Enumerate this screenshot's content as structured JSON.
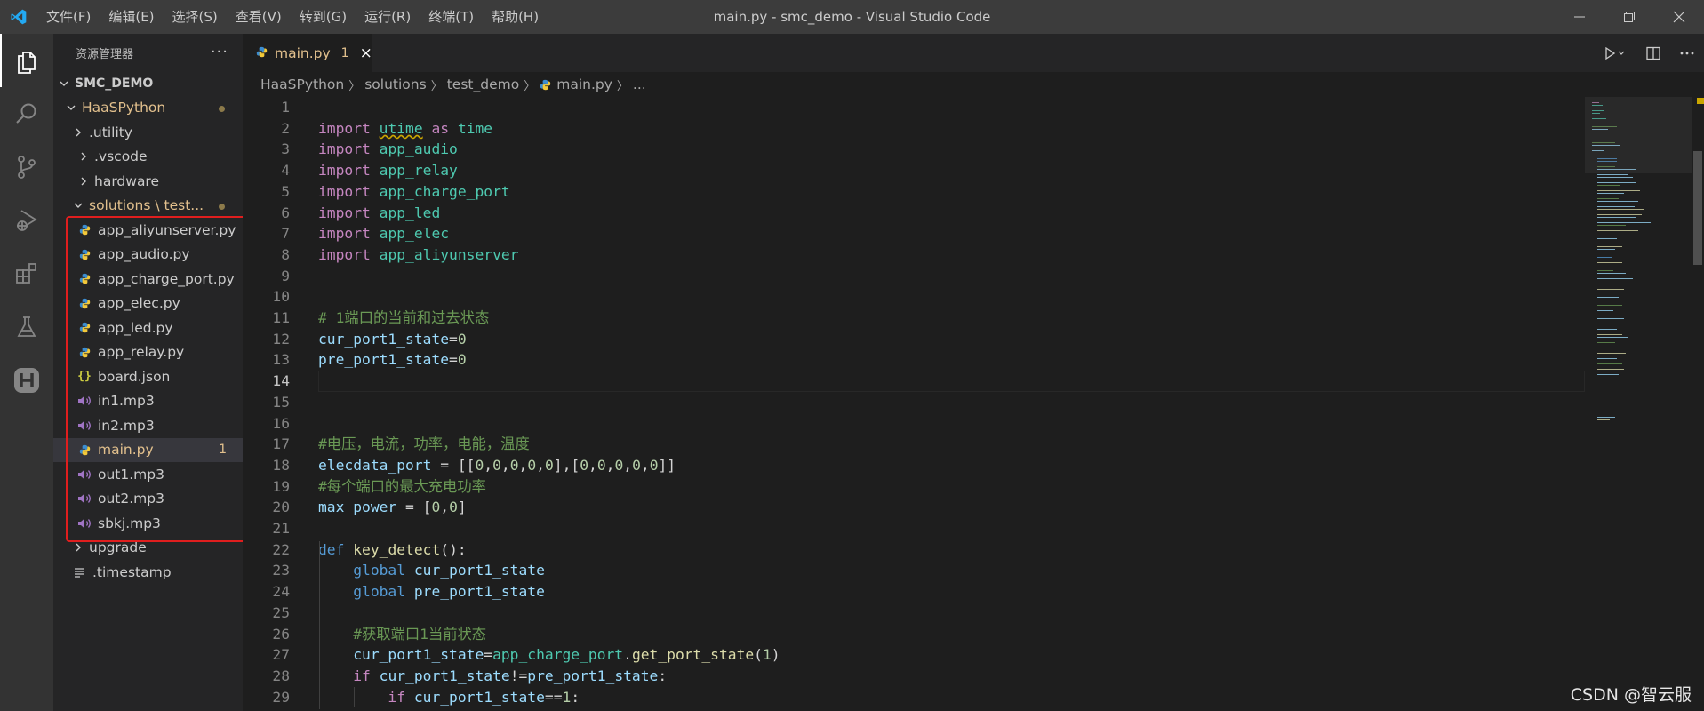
{
  "titlebar": {
    "menu": [
      "文件(F)",
      "编辑(E)",
      "选择(S)",
      "查看(V)",
      "转到(G)",
      "运行(R)",
      "终端(T)",
      "帮助(H)"
    ],
    "window_title": "main.py - smc_demo - Visual Studio Code"
  },
  "activity_bar": {
    "items": [
      "files-icon",
      "search-icon",
      "source-control-icon",
      "run-debug-icon",
      "extensions-icon",
      "testing-flask-icon",
      "haas-icon"
    ],
    "active": "files-icon"
  },
  "sidebar": {
    "title": "资源管理器",
    "more": "···",
    "root": "SMC_DEMO",
    "tree": [
      {
        "label": "HaaSPython",
        "type": "folder",
        "expanded": true,
        "modified": true
      },
      {
        "label": ".utility",
        "type": "folder",
        "expanded": false
      },
      {
        "label": ".vscode",
        "type": "folder",
        "expanded": false
      },
      {
        "label": "hardware",
        "type": "folder",
        "expanded": false
      },
      {
        "label": "solutions \\ test...",
        "type": "folder",
        "expanded": true,
        "modified": true
      },
      {
        "label": "app_aliyunserver.py",
        "type": "py"
      },
      {
        "label": "app_audio.py",
        "type": "py"
      },
      {
        "label": "app_charge_port.py",
        "type": "py"
      },
      {
        "label": "app_elec.py",
        "type": "py"
      },
      {
        "label": "app_led.py",
        "type": "py"
      },
      {
        "label": "app_relay.py",
        "type": "py"
      },
      {
        "label": "board.json",
        "type": "json"
      },
      {
        "label": "in1.mp3",
        "type": "mp3"
      },
      {
        "label": "in2.mp3",
        "type": "mp3"
      },
      {
        "label": "main.py",
        "type": "py",
        "selected": true,
        "badge": "1"
      },
      {
        "label": "out1.mp3",
        "type": "mp3"
      },
      {
        "label": "out2.mp3",
        "type": "mp3"
      },
      {
        "label": "sbkj.mp3",
        "type": "mp3"
      },
      {
        "label": "upgrade",
        "type": "folder",
        "expanded": false
      },
      {
        "label": ".timestamp",
        "type": "text"
      }
    ]
  },
  "editor": {
    "tab": {
      "label": "main.py",
      "problems": "1",
      "close": "×"
    },
    "breadcrumb": [
      "HaaSPython",
      "solutions",
      "test_demo",
      "main.py",
      "..."
    ],
    "current_line": 14,
    "lines": [
      {
        "n": "1",
        "tokens": []
      },
      {
        "n": "2",
        "tokens": [
          [
            "k",
            "import"
          ],
          [
            "p",
            " "
          ],
          [
            "m sq",
            "utime"
          ],
          [
            "p",
            " "
          ],
          [
            "k",
            "as"
          ],
          [
            "p",
            " "
          ],
          [
            "m",
            "time"
          ]
        ]
      },
      {
        "n": "3",
        "tokens": [
          [
            "k",
            "import"
          ],
          [
            "p",
            " "
          ],
          [
            "m",
            "app_audio"
          ]
        ]
      },
      {
        "n": "4",
        "tokens": [
          [
            "k",
            "import"
          ],
          [
            "p",
            " "
          ],
          [
            "m",
            "app_relay"
          ]
        ]
      },
      {
        "n": "5",
        "tokens": [
          [
            "k",
            "import"
          ],
          [
            "p",
            " "
          ],
          [
            "m",
            "app_charge_port"
          ]
        ]
      },
      {
        "n": "6",
        "tokens": [
          [
            "k",
            "import"
          ],
          [
            "p",
            " "
          ],
          [
            "m",
            "app_led"
          ]
        ]
      },
      {
        "n": "7",
        "tokens": [
          [
            "k",
            "import"
          ],
          [
            "p",
            " "
          ],
          [
            "m",
            "app_elec"
          ]
        ]
      },
      {
        "n": "8",
        "tokens": [
          [
            "k",
            "import"
          ],
          [
            "p",
            " "
          ],
          [
            "m",
            "app_aliyunserver"
          ]
        ]
      },
      {
        "n": "9",
        "tokens": []
      },
      {
        "n": "10",
        "tokens": []
      },
      {
        "n": "11",
        "tokens": [
          [
            "c",
            "# 1端口的当前和过去状态"
          ]
        ]
      },
      {
        "n": "12",
        "tokens": [
          [
            "v",
            "cur_port1_state"
          ],
          [
            "p",
            "="
          ],
          [
            "n",
            "0"
          ]
        ]
      },
      {
        "n": "13",
        "tokens": [
          [
            "v",
            "pre_port1_state"
          ],
          [
            "p",
            "="
          ],
          [
            "n",
            "0"
          ]
        ]
      },
      {
        "n": "14",
        "tokens": []
      },
      {
        "n": "15",
        "tokens": []
      },
      {
        "n": "16",
        "tokens": []
      },
      {
        "n": "17",
        "tokens": [
          [
            "c",
            "#电压，电流，功率，电能，温度"
          ]
        ]
      },
      {
        "n": "18",
        "tokens": [
          [
            "v",
            "elecdata_port"
          ],
          [
            "p",
            " = [["
          ],
          [
            "n",
            "0"
          ],
          [
            "p",
            ","
          ],
          [
            "n",
            "0"
          ],
          [
            "p",
            ","
          ],
          [
            "n",
            "0"
          ],
          [
            "p",
            ","
          ],
          [
            "n",
            "0"
          ],
          [
            "p",
            ","
          ],
          [
            "n",
            "0"
          ],
          [
            "p",
            "],["
          ],
          [
            "n",
            "0"
          ],
          [
            "p",
            ","
          ],
          [
            "n",
            "0"
          ],
          [
            "p",
            ","
          ],
          [
            "n",
            "0"
          ],
          [
            "p",
            ","
          ],
          [
            "n",
            "0"
          ],
          [
            "p",
            ","
          ],
          [
            "n",
            "0"
          ],
          [
            "p",
            "]]"
          ]
        ]
      },
      {
        "n": "19",
        "tokens": [
          [
            "c",
            "#每个端口的最大充电功率"
          ]
        ]
      },
      {
        "n": "20",
        "tokens": [
          [
            "v",
            "max_power"
          ],
          [
            "p",
            " = ["
          ],
          [
            "n",
            "0"
          ],
          [
            "p",
            ","
          ],
          [
            "n",
            "0"
          ],
          [
            "p",
            "]"
          ]
        ]
      },
      {
        "n": "21",
        "tokens": []
      },
      {
        "n": "22",
        "tokens": [
          [
            "kb",
            "def"
          ],
          [
            "p",
            " "
          ],
          [
            "f",
            "key_detect"
          ],
          [
            "p",
            "():"
          ]
        ]
      },
      {
        "n": "23",
        "tokens": [
          [
            "p",
            "    "
          ],
          [
            "kb",
            "global"
          ],
          [
            "p",
            " "
          ],
          [
            "v",
            "cur_port1_state"
          ]
        ]
      },
      {
        "n": "24",
        "tokens": [
          [
            "p",
            "    "
          ],
          [
            "kb",
            "global"
          ],
          [
            "p",
            " "
          ],
          [
            "v",
            "pre_port1_state"
          ]
        ]
      },
      {
        "n": "25",
        "tokens": []
      },
      {
        "n": "26",
        "tokens": [
          [
            "p",
            "    "
          ],
          [
            "c",
            "#获取端口1当前状态"
          ]
        ]
      },
      {
        "n": "27",
        "tokens": [
          [
            "p",
            "    "
          ],
          [
            "v",
            "cur_port1_state"
          ],
          [
            "p",
            "="
          ],
          [
            "m",
            "app_charge_port"
          ],
          [
            "p",
            "."
          ],
          [
            "f",
            "get_port_state"
          ],
          [
            "p",
            "("
          ],
          [
            "n",
            "1"
          ],
          [
            "p",
            ")"
          ]
        ]
      },
      {
        "n": "28",
        "tokens": [
          [
            "p",
            "    "
          ],
          [
            "k",
            "if"
          ],
          [
            "p",
            " "
          ],
          [
            "v",
            "cur_port1_state"
          ],
          [
            "p",
            "!="
          ],
          [
            "v",
            "pre_port1_state"
          ],
          [
            "p",
            ":"
          ]
        ]
      },
      {
        "n": "29",
        "tokens": [
          [
            "p",
            "        "
          ],
          [
            "k",
            "if"
          ],
          [
            "p",
            " "
          ],
          [
            "v",
            "cur_port1_state"
          ],
          [
            "p",
            "=="
          ],
          [
            "n",
            "1"
          ],
          [
            "p",
            ":"
          ]
        ]
      }
    ]
  },
  "watermark": "CSDN @智云服",
  "colors": {
    "keyword": "#c586c0",
    "def_global": "#569cd6",
    "module": "#4ec9b0",
    "variable": "#9cdcfe",
    "function": "#dcdcaa",
    "comment": "#6a9955",
    "number": "#b5cea8",
    "modified": "#e2c08d",
    "highlight_box": "#e01e1e"
  }
}
